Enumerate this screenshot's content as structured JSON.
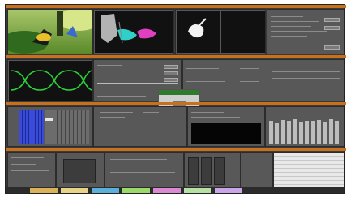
{
  "colors": {
    "accent_orange": "#c8701e",
    "pane_gray": "#585858",
    "waveform_green": "#2bd13a",
    "vector_blue": "#3a4bd8",
    "dialog_green": "#2f7a2f"
  },
  "dialog": {
    "button_label": "OK"
  },
  "taskbar": {
    "items": [
      {
        "color": "#d9b25a"
      },
      {
        "color": "#e8d38a"
      },
      {
        "color": "#5ab0d9"
      },
      {
        "color": "#9bd96a"
      },
      {
        "color": "#d98ad3"
      },
      {
        "color": "#b7e0a5"
      },
      {
        "color": "#c9a6e8"
      }
    ]
  },
  "meters": {
    "levels": [
      0.7,
      0.65,
      0.72,
      0.68,
      0.74,
      0.66,
      0.7,
      0.69,
      0.71,
      0.67,
      0.73,
      0.7
    ]
  }
}
